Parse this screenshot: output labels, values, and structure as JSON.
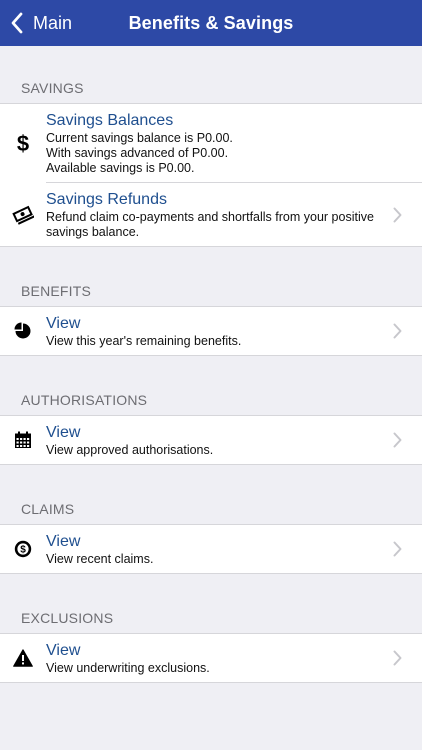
{
  "nav": {
    "back_label": "Main",
    "title": "Benefits & Savings"
  },
  "sections": {
    "savings": {
      "header": "SAVINGS",
      "balances": {
        "title": "Savings Balances",
        "line1": "Current savings balance is P0.00.",
        "line2": "With savings advanced of P0.00.",
        "line3": "Available savings is P0.00."
      },
      "refunds": {
        "title": "Savings Refunds",
        "desc": "Refund claim co-payments and shortfalls from your positive savings balance."
      }
    },
    "benefits": {
      "header": "BENEFITS",
      "title": "View",
      "desc": "View this year's remaining benefits."
    },
    "authorisations": {
      "header": "AUTHORISATIONS",
      "title": "View",
      "desc": "View approved authorisations."
    },
    "claims": {
      "header": "CLAIMS",
      "title": "View",
      "desc": "View recent claims."
    },
    "exclusions": {
      "header": "EXCLUSIONS",
      "title": "View",
      "desc": "View underwriting exclusions."
    }
  },
  "colors": {
    "navbar": "#2d49a6",
    "link_title": "#1f4f8f",
    "background": "#efeff4"
  },
  "icons": [
    "chevron-left-icon",
    "dollar-icon",
    "cash-icon",
    "pie-chart-icon",
    "calendar-icon",
    "coin-icon",
    "warning-icon",
    "chevron-right-icon"
  ]
}
